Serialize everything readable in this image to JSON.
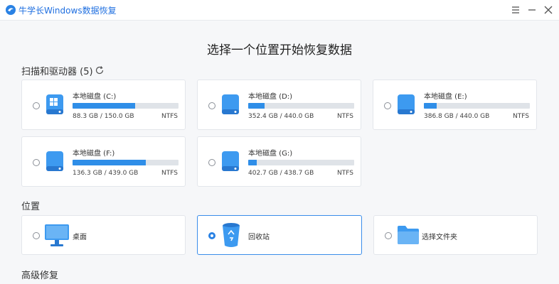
{
  "app": {
    "title": "牛学长Windows数据恢复"
  },
  "main": {
    "heading": "选择一个位置开始恢复数据",
    "drives_section": "扫描和驱动器 (5)",
    "locations_section": "位置",
    "advanced_section": "高级修复"
  },
  "drives": [
    {
      "name": "本地磁盘 (C:)",
      "size": "88.3 GB / 150.0 GB",
      "fs": "NTFS",
      "used_fraction": 0.589,
      "system": true
    },
    {
      "name": "本地磁盘 (D:)",
      "size": "352.4 GB / 440.0 GB",
      "fs": "NTFS",
      "used_fraction": 0.154
    },
    {
      "name": "本地磁盘 (E:)",
      "size": "386.8 GB / 440.0 GB",
      "fs": "NTFS",
      "used_fraction": 0.121
    },
    {
      "name": "本地磁盘 (F:)",
      "size": "136.3 GB / 439.0 GB",
      "fs": "NTFS",
      "used_fraction": 0.69
    },
    {
      "name": "本地磁盘 (G:)",
      "size": "402.7 GB / 438.7 GB",
      "fs": "NTFS",
      "used_fraction": 0.082
    }
  ],
  "locations": [
    {
      "label": "桌面",
      "icon": "monitor-icon",
      "selected": false
    },
    {
      "label": "回收站",
      "icon": "recycle-bin-icon",
      "selected": true
    },
    {
      "label": "选择文件夹",
      "icon": "folder-icon",
      "selected": false
    }
  ],
  "colors": {
    "accent": "#2a82e4",
    "bar_fill": "#2f8ee8",
    "bar_track": "#dfe3e8"
  }
}
